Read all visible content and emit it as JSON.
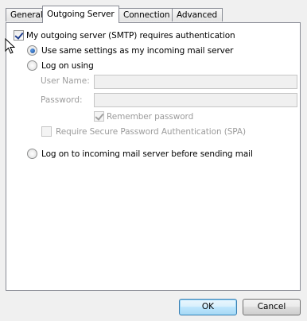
{
  "tabs": [
    {
      "label": "General"
    },
    {
      "label": "Outgoing Server"
    },
    {
      "label": "Connection"
    },
    {
      "label": "Advanced"
    }
  ],
  "outgoing": {
    "smtp_auth_label": "My outgoing server (SMTP) requires authentication",
    "use_same_label": "Use same settings as my incoming mail server",
    "log_on_using_label": "Log on using",
    "user_name_label": "User Name:",
    "user_name_value": "",
    "password_label": "Password:",
    "password_value": "",
    "remember_password_label": "Remember password",
    "spa_label": "Require Secure Password Authentication (SPA)",
    "log_on_incoming_label": "Log on to incoming mail server before sending mail"
  },
  "buttons": {
    "ok": "OK",
    "cancel": "Cancel"
  },
  "icons": {
    "cursor": "mouse-pointer-icon"
  }
}
